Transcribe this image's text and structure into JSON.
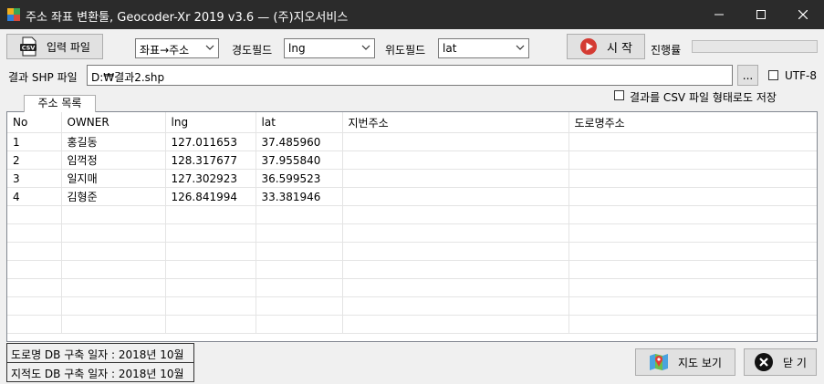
{
  "window": {
    "title": "주소 좌표 변환툴, Geocoder-Xr 2019 v3.6 — (주)지오서비스"
  },
  "toolbar": {
    "input_file_label": "입력 파일",
    "mode_value": "좌표→주소",
    "lng_field_label": "경도필드",
    "lng_field_value": "lng",
    "lat_field_label": "위도필드",
    "lat_field_value": "lat",
    "start_label": "시 작",
    "progress_label": "진행률",
    "progress_value": 0
  },
  "output": {
    "label": "결과 SHP 파일",
    "path": "D:₩결과2.shp",
    "browse_label": "...",
    "utf8_label": "UTF-8",
    "utf8_checked": false,
    "csv_label": "결과를 CSV 파일 형태로도 저장",
    "csv_checked": false
  },
  "tab": {
    "label": "주소 목록"
  },
  "table": {
    "columns": [
      "No",
      "OWNER",
      "lng",
      "lat",
      "지번주소",
      "도로명주소"
    ],
    "rows": [
      [
        "1",
        "홍길동",
        "127.011653",
        "37.485960",
        "",
        ""
      ],
      [
        "2",
        "임꺽정",
        "128.317677",
        "37.955840",
        "",
        ""
      ],
      [
        "3",
        "일지매",
        "127.302923",
        "36.599523",
        "",
        ""
      ],
      [
        "4",
        "김형준",
        "126.841994",
        "33.381946",
        "",
        ""
      ]
    ]
  },
  "status": {
    "road_db": "도로명 DB 구축 일자 : 2018년 10월",
    "lot_db": "지적도 DB 구축 일자 : 2018년 10월"
  },
  "footer": {
    "map_label": "지도 보기",
    "close_label": "닫 기"
  }
}
